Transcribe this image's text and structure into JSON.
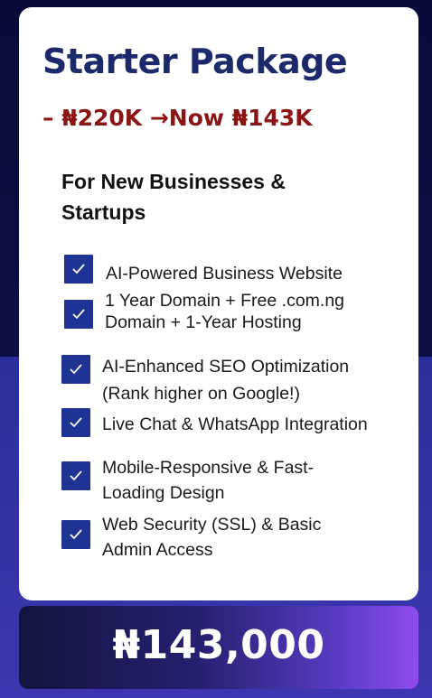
{
  "package": {
    "title": "Starter Package",
    "price_line": "– ₦220K →Now ₦143K",
    "subtitle": "For New Businesses & Startups"
  },
  "features": [
    {
      "text": "AI-Powered Business Website",
      "icon": "checkbox-checked-icon"
    },
    {
      "text": " 1 Year Domain +  Free .com.ng\nDomain + 1-Year Hosting",
      "icon": "checkbox-checked-icon"
    },
    {
      "text": "AI-Enhanced  SEO  Optimization\n(Rank higher on Google!)",
      "icon": "checkbox-checked-icon"
    },
    {
      "text": "Live Chat & WhatsApp Integration",
      "icon": "checkbox-checked-icon"
    },
    {
      "text": " Mobile-Responsive & Fast-\nLoading Design",
      "icon": "checkbox-checked-icon"
    },
    {
      "text": "Web Security (SSL) & Basic\nAdmin Access",
      "icon": "checkbox-checked-icon"
    }
  ],
  "total_price": "₦143,000",
  "colors": {
    "title": "#1c2a6b",
    "price_line": "#8b1414",
    "checkbox": "#1f3395",
    "background_top": "#0b0b3a",
    "background_bottom": "#3d36b0"
  }
}
